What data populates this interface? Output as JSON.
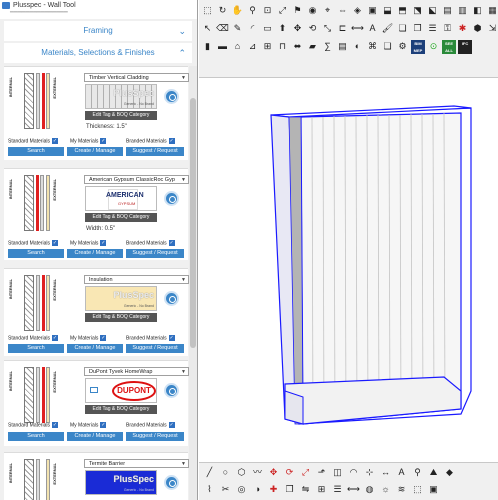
{
  "window": {
    "title": "Plusspec - Wall Tool",
    "menu_hint": "▔▔▔▔▔▔▔▔▔▔▔▔▔▔▔"
  },
  "sections": {
    "framing": "Framing",
    "materials": "Materials, Selections & Finishes"
  },
  "wall_labels": {
    "internal": "INTERNAL",
    "external": "EXTERNAL"
  },
  "common": {
    "tag_button": "Edit Tag & BOQ Category",
    "standard": "Standard Materials",
    "my": "My Materials",
    "branded": "Branded Materials",
    "search": "Search",
    "create": "Create / Manage",
    "suggest": "Suggest / Request"
  },
  "cards": [
    {
      "material": "Timber Vertical Cladding",
      "brand": "PlusSpec",
      "brand_sub": "Generic - No Brand",
      "measure": "Thickness: 1.5\""
    },
    {
      "material": "American Gypsum ClassicRoc Gyp",
      "brand": "AMERICAN",
      "brand_sub": "GYPSUM",
      "measure": "Width: 0.5\""
    },
    {
      "material": "Insulation",
      "brand": "PlusSpec",
      "brand_sub": "Generic - No Brand",
      "measure": ""
    },
    {
      "material": "DuPont Tyvek HomeWrap",
      "brand": "DUPONT",
      "brand_sub": "",
      "measure": ""
    },
    {
      "material": "Termite Barrier",
      "brand": "PlusSpec",
      "brand_sub": "Generic - No Brand",
      "measure": ""
    }
  ],
  "toolbar": {
    "row3_labels": [
      "BIM MEP",
      "SEE ALL",
      "IFC"
    ]
  },
  "colors": {
    "accent": "#3b86c8",
    "selection": "#1a1aff"
  }
}
